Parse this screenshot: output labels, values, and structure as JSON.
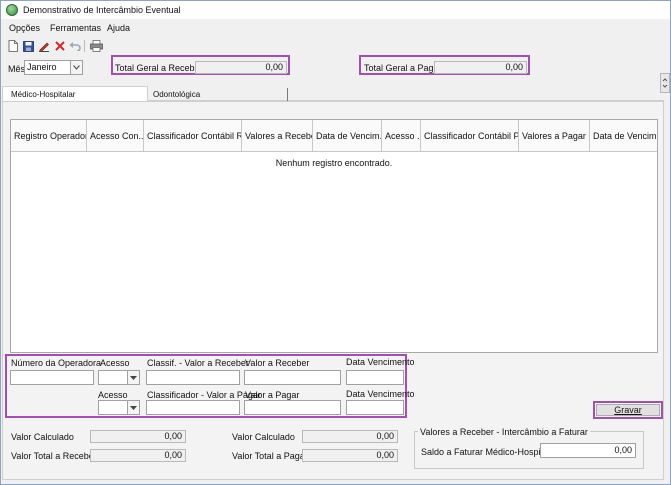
{
  "window": {
    "title": "Demonstrativo de Intercâmbio Eventual"
  },
  "menu": {
    "items": [
      "Opções",
      "Ferramentas",
      "Ajuda"
    ]
  },
  "toolbar": {
    "icons": [
      "new-document-icon",
      "save-icon",
      "edit-icon",
      "delete-icon",
      "undo-icon",
      "print-icon"
    ]
  },
  "filters": {
    "mes_label": "Mês",
    "mes_value": "Janeiro",
    "total_receber_label": "Total Geral a Receber:",
    "total_receber_value": "0,00",
    "total_pagar_label": "Total Geral a Pagar:",
    "total_pagar_value": "0,00"
  },
  "tabs": [
    "Médico-Hospitalar",
    "Odontológica"
  ],
  "grid": {
    "columns": [
      "Registro Operadora",
      "Acesso Con...",
      "Classificador Contábil R...",
      "Valores a Receber",
      "Data de Vencim...",
      "Acesso ...",
      "Classificador Contábil P...",
      "Valores a Pagar",
      "Data de Vencim..."
    ],
    "empty_message": "Nenhum registro encontrado."
  },
  "form": {
    "numero_operadora_label": "Número da Operadora",
    "acesso_label_1": "Acesso",
    "classif_receber_label": "Classif. - Valor a Receber",
    "valor_receber_label": "Valor a Receber",
    "data_venc_label_1": "Data Vencimento",
    "acesso_label_2": "Acesso",
    "classif_pagar_label": "Classificador - Valor a Pagar",
    "valor_pagar_label": "Valor a Pagar",
    "data_venc_label_2": "Data Vencimento",
    "gravar_label": "Gravar"
  },
  "summary": {
    "valor_calculado_label_1": "Valor Calculado",
    "valor_calculado_value_1": "0,00",
    "valor_total_receber_label": "Valor Total a Receber",
    "valor_total_receber_value": "0,00",
    "valor_calculado_label_2": "Valor Calculado",
    "valor_calculado_value_2": "0,00",
    "valor_total_pagar_label": "Valor Total a Pagar",
    "valor_total_pagar_value": "0,00",
    "group_title": "Valores a Receber - Intercâmbio a Faturar",
    "saldo_label": "Saldo a Faturar Médico-Hospitalar",
    "saldo_value": "0,00"
  },
  "colors": {
    "highlight": "#a14fb5",
    "border": "#a9a9a9"
  }
}
